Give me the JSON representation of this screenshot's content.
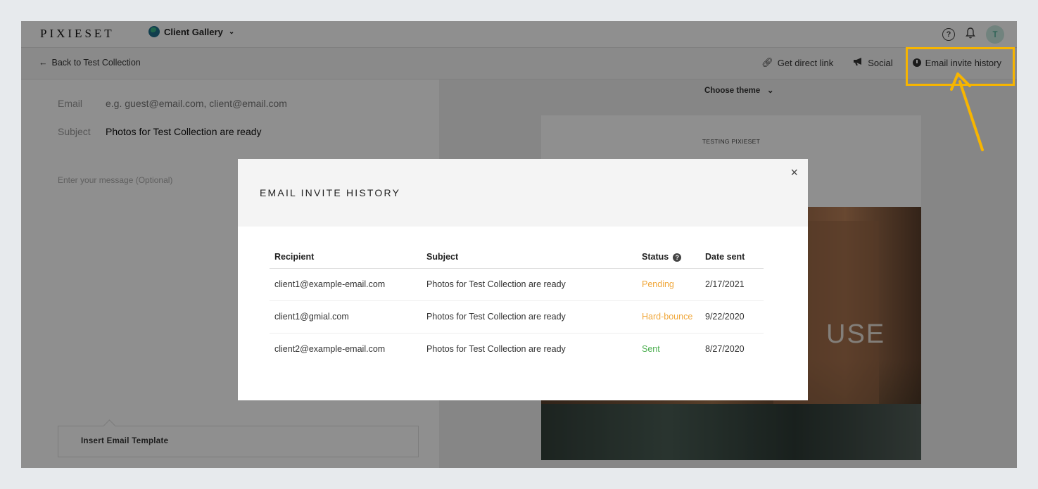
{
  "topbar": {
    "logo": "PIXIESET",
    "app_name": "Client Gallery",
    "help_icon": "?",
    "avatar_initial": "T"
  },
  "subbar": {
    "back_label": "Back to Test Collection",
    "direct_link_label": "Get direct link",
    "social_label": "Social",
    "history_label": "Email invite history"
  },
  "form": {
    "email_label": "Email",
    "email_placeholder": "e.g. guest@email.com, client@email.com",
    "subject_label": "Subject",
    "subject_value": "Photos for Test Collection are ready",
    "message_placeholder": "Enter your message (Optional)",
    "template_button": "Insert Email Template"
  },
  "preview": {
    "choose_theme": "Choose theme",
    "brand": "TESTING PIXIESET",
    "photo_sign": "USE"
  },
  "modal": {
    "title": "EMAIL INVITE HISTORY",
    "close": "×",
    "columns": [
      "Recipient",
      "Subject",
      "Status",
      "Date sent"
    ],
    "status_help": "?",
    "rows": [
      {
        "recipient": "client1@example-email.com",
        "subject": "Photos for Test Collection are ready",
        "status": "Pending",
        "date": "2/17/2021"
      },
      {
        "recipient": "client1@gmial.com",
        "subject": "Photos for Test Collection are ready",
        "status": "Hard-bounce",
        "date": "9/22/2020"
      },
      {
        "recipient": "client2@example-email.com",
        "subject": "Photos for Test Collection are ready",
        "status": "Sent",
        "date": "8/27/2020"
      }
    ]
  },
  "colors": {
    "pending": "#f0a73a",
    "hard_bounce": "#f0a73a",
    "sent": "#4caf50",
    "highlight": "#f7b500"
  }
}
